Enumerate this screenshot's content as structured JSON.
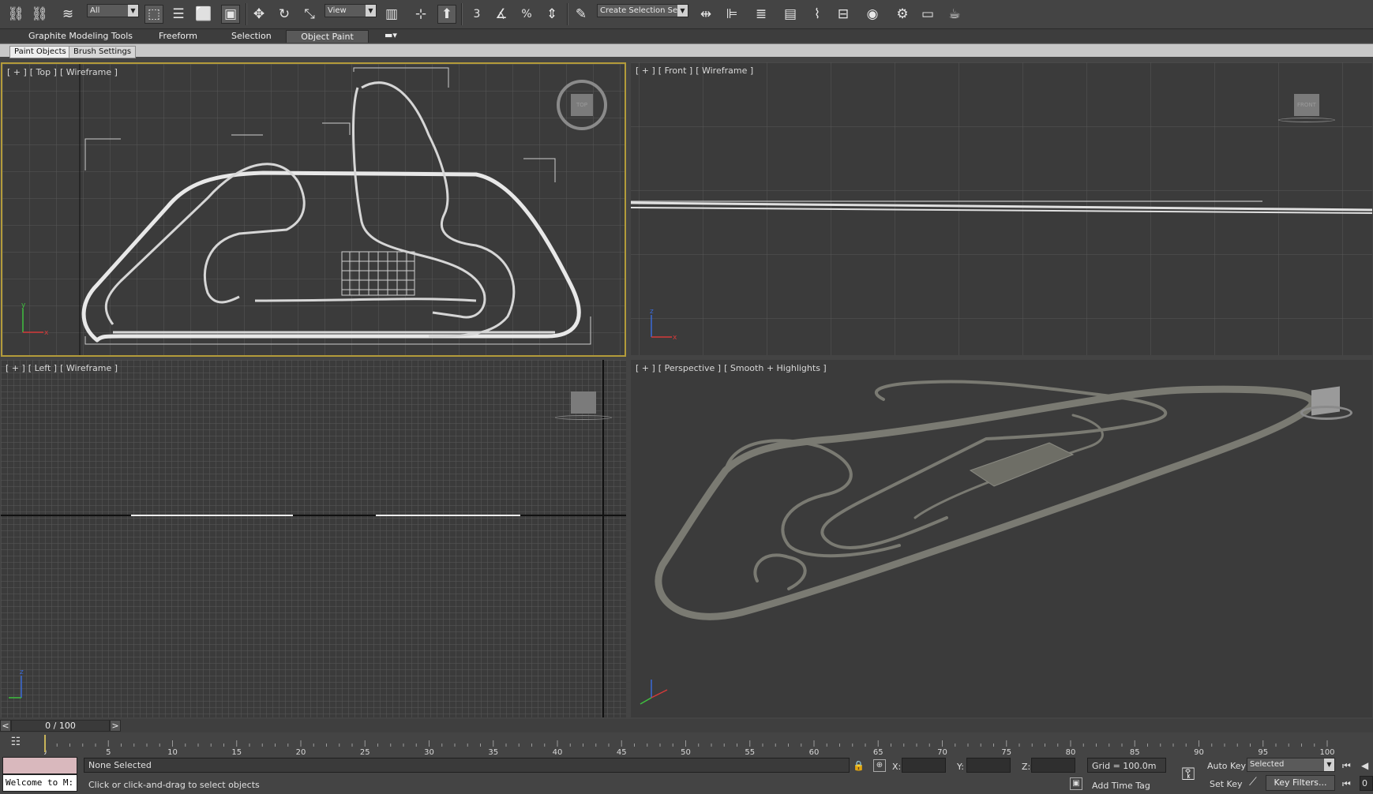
{
  "toolbar": {
    "filter_combo": "All",
    "refcoord_combo": "View",
    "named_selection": "Create Selection Se",
    "snap_label": "3",
    "angle_snap_label": "%",
    "icons": [
      "link-icon",
      "unlink-icon",
      "bind-space-warp-icon",
      "select-object-icon",
      "select-by-name-icon",
      "rect-selection-icon",
      "window-crossing-icon",
      "move-icon",
      "rotate-icon",
      "scale-icon",
      "pivot-icon",
      "select-manipulate-icon",
      "keyboard-shortcut-icon",
      "snaps-toggle-icon",
      "angle-snap-icon",
      "percent-snap-icon",
      "spinner-snap-icon",
      "edit-named-selection-icon",
      "mirror-icon",
      "align-icon",
      "layer-manager-icon",
      "graphite-toggle-icon",
      "curve-editor-icon",
      "schematic-view-icon",
      "material-editor-icon",
      "render-setup-icon",
      "rendered-frame-icon",
      "render-production-icon"
    ]
  },
  "ribbon": {
    "tabs": [
      "Graphite Modeling Tools",
      "Freeform",
      "Selection",
      "Object Paint"
    ],
    "active_tab": "Object Paint",
    "subtabs": [
      "Paint Objects",
      "Brush Settings"
    ]
  },
  "viewports": {
    "top": {
      "plus": "[ + ]",
      "view": "[ Top ]",
      "shading": "[ Wireframe ]",
      "cube": "TOP"
    },
    "front": {
      "plus": "[ + ]",
      "view": "[ Front ]",
      "shading": "[ Wireframe ]",
      "cube": "FRONT"
    },
    "left": {
      "plus": "[ + ]",
      "view": "[ Left ]",
      "shading": "[ Wireframe ]",
      "cube": ""
    },
    "perspective": {
      "plus": "[ + ]",
      "view": "[ Perspective ]",
      "shading": "[ Smooth + Highlights ]",
      "cube": ""
    }
  },
  "timeline": {
    "frame_display": "0 / 100",
    "prev_label": "<",
    "next_label": ">",
    "ticks": [
      "0",
      "5",
      "10",
      "15",
      "20",
      "25",
      "30",
      "35",
      "40",
      "45",
      "50",
      "55",
      "60",
      "65",
      "70",
      "75",
      "80",
      "85",
      "90",
      "95",
      "100"
    ],
    "max_frame": 100
  },
  "status": {
    "maxscript": "Welcome to M:",
    "selection_status": "None Selected",
    "prompt": "Click or click-and-drag to select objects",
    "x_label": "X:",
    "y_label": "Y:",
    "z_label": "Z:",
    "x_value": "",
    "y_value": "",
    "z_value": "",
    "grid": "Grid = 100.0m",
    "add_time_tag": "Add Time Tag",
    "auto_key": "Auto Key",
    "set_key": "Set Key",
    "key_mode": "Selected",
    "key_filters": "Key Filters...",
    "frame_field": "0"
  },
  "colors": {
    "viewport_bg": "#3b3b3b",
    "grid_line": "#5a5a5a",
    "active_border": "#b39b3a",
    "wire": "#e6e6e6",
    "track_shaded": "#7a7a72",
    "maxscript_bg": "#d9b8bd"
  }
}
